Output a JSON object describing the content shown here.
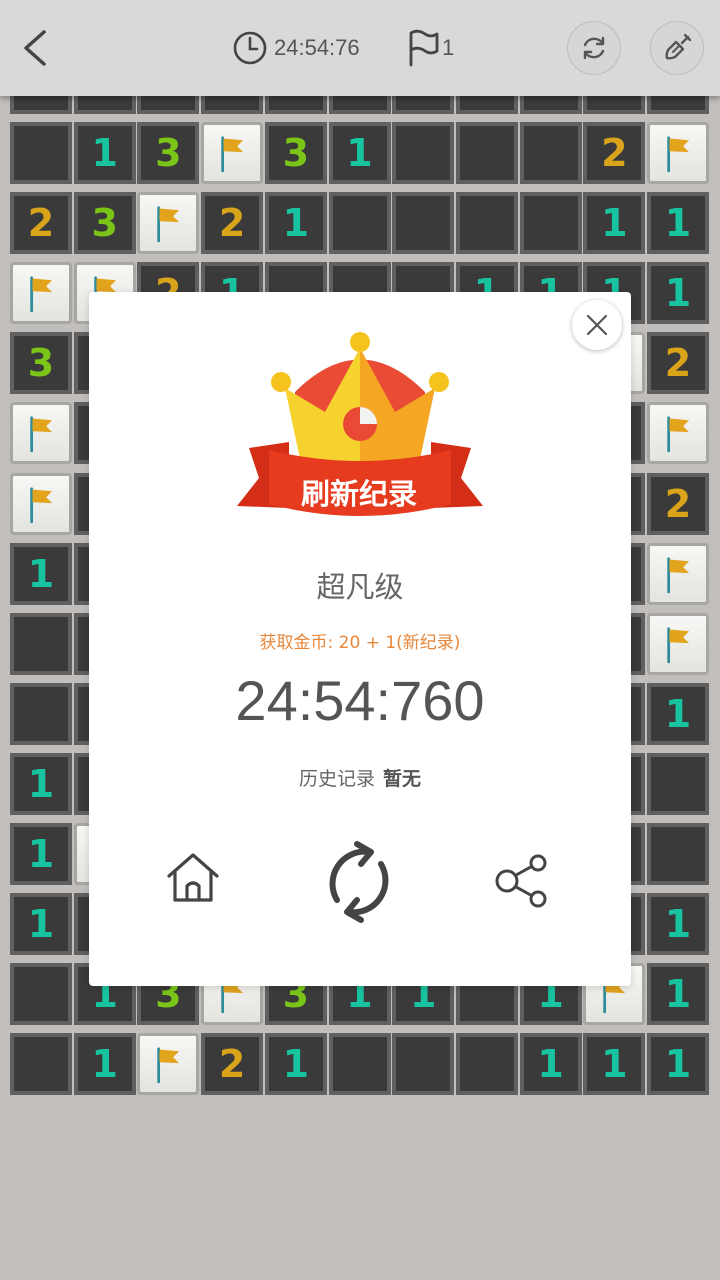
{
  "header": {
    "timer_text": "24:54:76",
    "flag_count": "1"
  },
  "board": {
    "rows": [
      [
        "e",
        "1",
        "3",
        "F",
        "3",
        "1",
        "e",
        "e",
        "e",
        "2",
        "F"
      ],
      [
        "2",
        "3",
        "F",
        "2",
        "1",
        "e",
        "e",
        "e",
        "e",
        "1",
        "1"
      ],
      [
        "F",
        "F",
        "2",
        "1",
        "e",
        "e",
        "e",
        "1",
        "1",
        "1",
        "1"
      ],
      [
        "3",
        "e",
        "e",
        "e",
        "e",
        "e",
        "e",
        "e",
        "e",
        "h",
        "2"
      ],
      [
        "F",
        "e",
        "e",
        "e",
        "e",
        "e",
        "e",
        "e",
        "e",
        "e",
        "F"
      ],
      [
        "F",
        "e",
        "e",
        "e",
        "e",
        "e",
        "e",
        "e",
        "e",
        "e",
        "2"
      ],
      [
        "1",
        "e",
        "e",
        "e",
        "e",
        "e",
        "e",
        "e",
        "e",
        "e",
        "F"
      ],
      [
        "e",
        "e",
        "e",
        "e",
        "e",
        "e",
        "e",
        "e",
        "e",
        "e",
        "F"
      ],
      [
        "e",
        "e",
        "e",
        "e",
        "e",
        "e",
        "e",
        "e",
        "e",
        "e",
        "1"
      ],
      [
        "1",
        "e",
        "e",
        "e",
        "e",
        "e",
        "e",
        "e",
        "e",
        "e",
        "e"
      ],
      [
        "1",
        "h",
        "e",
        "e",
        "e",
        "e",
        "e",
        "e",
        "e",
        "e",
        "e"
      ],
      [
        "1",
        "e",
        "e",
        "e",
        "e",
        "e",
        "e",
        "e",
        "e",
        "e",
        "1"
      ],
      [
        "e",
        "1",
        "3",
        "F",
        "3",
        "1",
        "1",
        "e",
        "1",
        "F",
        "1"
      ],
      [
        "e",
        "1",
        "F",
        "2",
        "1",
        "e",
        "e",
        "e",
        "1",
        "1",
        "1"
      ]
    ]
  },
  "result": {
    "ribbon_text": "刷新纪录",
    "level_name": "超凡级",
    "coins_text": "获取金币: 20 + 1(新纪录)",
    "final_time": "24:54:760",
    "history_label": "历史记录",
    "history_value": "暂无"
  },
  "colors": {
    "num1": "#18c3a0",
    "num2": "#d9a41a",
    "num3": "#7bc518",
    "flag": "#e2a31d",
    "crown_left": "#f6d22e",
    "crown_right": "#f5a623",
    "crown_top": "#ea4b35",
    "ribbon": "#e63b1f",
    "coins": "#e8873a"
  }
}
